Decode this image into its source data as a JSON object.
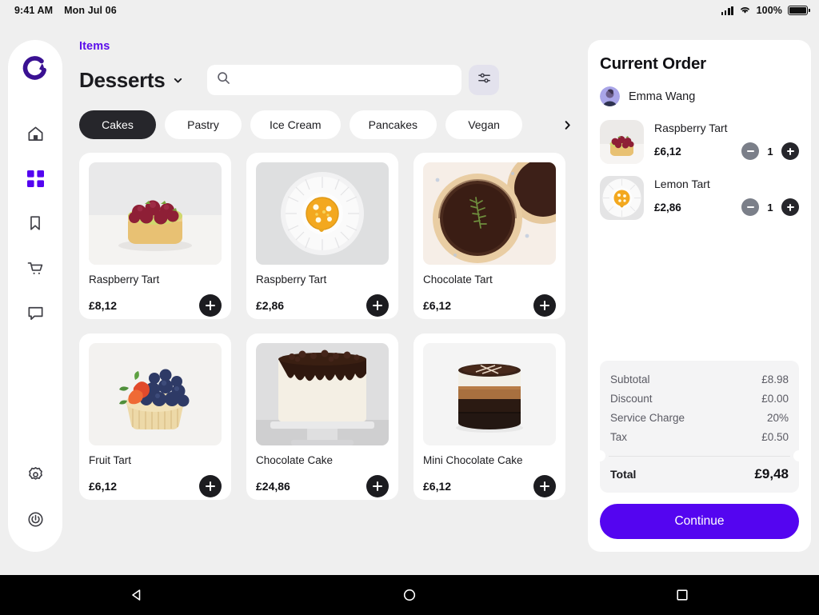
{
  "status_bar": {
    "time": "9:41 AM",
    "date": "Mon Jul 06",
    "battery_percent": "100%",
    "signal_icon": "signal-bars-icon",
    "wifi_icon": "wifi-icon",
    "battery_icon": "battery-full-icon"
  },
  "sidebar": {
    "logo": "app-logo",
    "items": [
      {
        "icon": "home-icon",
        "name": "home",
        "active": false
      },
      {
        "icon": "grid-icon",
        "name": "menu",
        "active": true
      },
      {
        "icon": "bookmark-icon",
        "name": "bookmarks",
        "active": false
      },
      {
        "icon": "cart-icon",
        "name": "orders",
        "active": false
      },
      {
        "icon": "chat-icon",
        "name": "messages",
        "active": false
      }
    ],
    "bottom_items": [
      {
        "icon": "gear-icon",
        "name": "settings"
      },
      {
        "icon": "power-icon",
        "name": "logout"
      }
    ]
  },
  "main": {
    "eyebrow": "Items",
    "category_title": "Desserts",
    "category_caret_icon": "chevron-down-icon",
    "search": {
      "value": "",
      "placeholder": "",
      "icon": "search-icon"
    },
    "filter_icon": "sliders-icon",
    "pills_next_icon": "chevron-right-icon",
    "pills": [
      {
        "label": "Cakes",
        "active": true
      },
      {
        "label": "Pastry",
        "active": false
      },
      {
        "label": "Ice Cream",
        "active": false
      },
      {
        "label": "Pancakes",
        "active": false
      },
      {
        "label": "Vegan",
        "active": false
      }
    ],
    "products": [
      {
        "name": "Raspberry Tart",
        "price": "£8,12",
        "photo": "raspberry-tart"
      },
      {
        "name": "Raspberry Tart",
        "price": "£2,86",
        "photo": "lemon-tart-plate"
      },
      {
        "name": "Chocolate Tart",
        "price": "£6,12",
        "photo": "chocolate-tart"
      },
      {
        "name": "Fruit Tart",
        "price": "£6,12",
        "photo": "fruit-tart"
      },
      {
        "name": "Chocolate Cake",
        "price": "£24,86",
        "photo": "chocolate-cake"
      },
      {
        "name": "Mini Chocolate Cake",
        "price": "£6,12",
        "photo": "mini-chocolate-cake"
      }
    ],
    "add_button_icon": "plus-icon"
  },
  "order": {
    "title": "Current Order",
    "customer": "Emma Wang",
    "avatar_icon": "avatar",
    "items": [
      {
        "name": "Raspberry Tart",
        "price": "£6,12",
        "qty": "1",
        "photo": "raspberry-tart"
      },
      {
        "name": "Lemon Tart",
        "price": "£2,86",
        "qty": "1",
        "photo": "lemon-tart-plate"
      }
    ],
    "minus_icon": "minus-icon",
    "plus_icon": "plus-icon",
    "summary": [
      {
        "label": "Subtotal",
        "value": "£8.98"
      },
      {
        "label": "Discount",
        "value": "£0.00"
      },
      {
        "label": "Service Charge",
        "value": "20%"
      },
      {
        "label": "Tax",
        "value": "£0.50"
      }
    ],
    "total_label": "Total",
    "total_value": "£9,48",
    "continue_label": "Continue"
  },
  "android_nav": {
    "back_icon": "triangle-back-icon",
    "home_icon": "circle-home-icon",
    "recents_icon": "square-recents-icon"
  },
  "colors": {
    "accent": "#5405f0",
    "eyebrow": "#5b0eeb",
    "dark": "#26262b",
    "page_bg": "#efefef",
    "panel_bg": "#ffffff",
    "summary_bg": "#f4f4f5",
    "minus_gray": "#7b7f89"
  }
}
